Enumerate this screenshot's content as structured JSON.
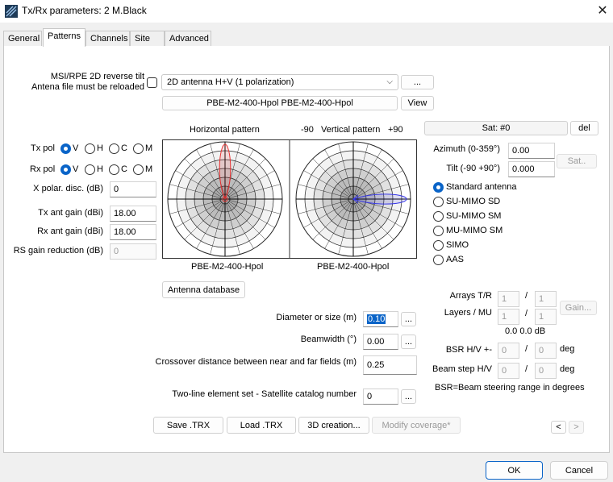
{
  "window": {
    "title": "Tx/Rx parameters: 2 M.Black",
    "close_glyph": "✕"
  },
  "tabs": [
    {
      "label": "General",
      "active": false
    },
    {
      "label": "Patterns",
      "active": true
    },
    {
      "label": "Channels",
      "active": false
    },
    {
      "label": "Site",
      "active": false
    },
    {
      "label": "Advanced",
      "active": false
    }
  ],
  "reverse_tilt": {
    "line1": "MSI/RPE 2D reverse tilt",
    "line2": "Antena file must be reloaded",
    "checked": false
  },
  "antenna_type": {
    "value": "2D antenna H+V (1 polarization)",
    "ellipsis": "..."
  },
  "antenna_file": {
    "label": "PBE-M2-400-Hpol PBE-M2-400-Hpol",
    "view": "View"
  },
  "patterns": {
    "horizontal_title": "Horizontal pattern",
    "vertical_minus": "-90",
    "vertical_title": "Vertical pattern",
    "vertical_plus": "+90",
    "horizontal_caption": "PBE-M2-400-Hpol",
    "vertical_caption": "PBE-M2-400-Hpol",
    "main_lobe_color": "#e83030",
    "vertical_lobe_color": "#3a3ae8"
  },
  "polarization": {
    "tx_label": "Tx pol",
    "rx_label": "Rx pol",
    "options": [
      "V",
      "H",
      "C",
      "M"
    ],
    "tx_selected": "V",
    "rx_selected": "V"
  },
  "fields": {
    "xpol_label": "X polar. disc. (dB)",
    "xpol_value": "0",
    "tx_gain_label": "Tx ant gain (dBi)",
    "tx_gain_value": "18.00",
    "rx_gain_label": "Rx ant gain (dBi)",
    "rx_gain_value": "18.00",
    "rs_label": "RS gain reduction (dB)",
    "rs_value": "0"
  },
  "antenna_db": "Antenna database",
  "sat": {
    "button": "Sat:  #0",
    "del": "del",
    "azimuth_label": "Azimuth (0-359°)",
    "azimuth_value": "0.00",
    "tilt_label": "Tilt (-90 +90°)",
    "tilt_value": "0.000",
    "sat_btn": "Sat.."
  },
  "antenna_modes": {
    "selected": "Standard antenna",
    "options": [
      "Standard antenna",
      "SU-MIMO SD",
      "SU-MIMO SM",
      "MU-MIMO SM",
      "SIMO",
      "AAS"
    ]
  },
  "mimo": {
    "arrays_label": "Arrays T/R",
    "arrays_t": "1",
    "arrays_r": "1",
    "layers_label": "Layers / MU",
    "layers_a": "1",
    "layers_b": "1",
    "gain_btn": "Gain...",
    "gain_text": "0.0 0.0 dB",
    "bsr_label": "BSR H/V +-",
    "bsr_h": "0",
    "bsr_v": "0",
    "deg1": "deg",
    "beam_step_label": "Beam step H/V",
    "step_h": "0",
    "step_v": "0",
    "deg2": "deg",
    "note": "BSR=Beam steering range in degrees",
    "slash": "/"
  },
  "geometry_fields": {
    "diameter_label": "Diameter or size (m)",
    "diameter_value": "0.10",
    "beamwidth_label": "Beamwidth (°)",
    "beamwidth_value": "0.00",
    "crossover_label": "Crossover distance between near and far fields (m)",
    "crossover_value": "0.25",
    "tle_label": "Two-line element set - Satellite catalog number",
    "tle_value": "0",
    "ellipsis": "..."
  },
  "actions": {
    "save": "Save .TRX",
    "load": "Load .TRX",
    "creation": "3D creation...",
    "modify": "Modify coverage*",
    "prev": "<",
    "next": ">"
  },
  "dialog": {
    "ok": "OK",
    "cancel": "Cancel"
  }
}
